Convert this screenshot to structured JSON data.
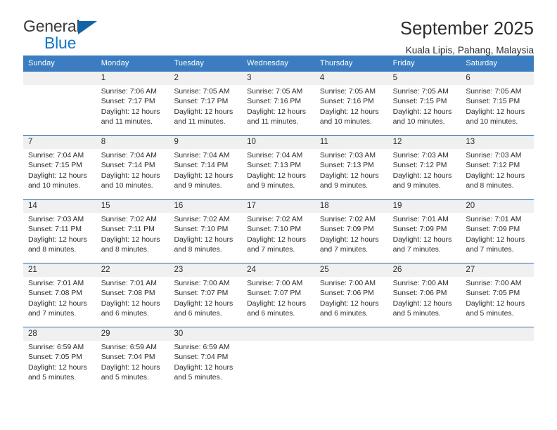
{
  "logo": {
    "primary_text": "General",
    "secondary_text": "Blue",
    "primary_color": "#3a3a3a",
    "secondary_color": "#1277c4",
    "triangle_color": "#1064a8"
  },
  "header": {
    "month_title": "September 2025",
    "location": "Kuala Lipis, Pahang, Malaysia"
  },
  "theme": {
    "header_bg": "#3b7dc0",
    "header_text": "#ffffff",
    "week_divider": "#2f6fad",
    "daynum_bg": "#f0f0f0",
    "body_text": "#2b2b2b"
  },
  "weekdays": [
    "Sunday",
    "Monday",
    "Tuesday",
    "Wednesday",
    "Thursday",
    "Friday",
    "Saturday"
  ],
  "weeks": [
    {
      "days": [
        {
          "date": "",
          "sunrise": "",
          "sunset": "",
          "daylight_line1": "",
          "daylight_line2": "",
          "empty": true
        },
        {
          "date": "1",
          "sunrise": "Sunrise: 7:06 AM",
          "sunset": "Sunset: 7:17 PM",
          "daylight_line1": "Daylight: 12 hours",
          "daylight_line2": "and 11 minutes.",
          "empty": false
        },
        {
          "date": "2",
          "sunrise": "Sunrise: 7:05 AM",
          "sunset": "Sunset: 7:17 PM",
          "daylight_line1": "Daylight: 12 hours",
          "daylight_line2": "and 11 minutes.",
          "empty": false
        },
        {
          "date": "3",
          "sunrise": "Sunrise: 7:05 AM",
          "sunset": "Sunset: 7:16 PM",
          "daylight_line1": "Daylight: 12 hours",
          "daylight_line2": "and 11 minutes.",
          "empty": false
        },
        {
          "date": "4",
          "sunrise": "Sunrise: 7:05 AM",
          "sunset": "Sunset: 7:16 PM",
          "daylight_line1": "Daylight: 12 hours",
          "daylight_line2": "and 10 minutes.",
          "empty": false
        },
        {
          "date": "5",
          "sunrise": "Sunrise: 7:05 AM",
          "sunset": "Sunset: 7:15 PM",
          "daylight_line1": "Daylight: 12 hours",
          "daylight_line2": "and 10 minutes.",
          "empty": false
        },
        {
          "date": "6",
          "sunrise": "Sunrise: 7:05 AM",
          "sunset": "Sunset: 7:15 PM",
          "daylight_line1": "Daylight: 12 hours",
          "daylight_line2": "and 10 minutes.",
          "empty": false
        }
      ]
    },
    {
      "days": [
        {
          "date": "7",
          "sunrise": "Sunrise: 7:04 AM",
          "sunset": "Sunset: 7:15 PM",
          "daylight_line1": "Daylight: 12 hours",
          "daylight_line2": "and 10 minutes.",
          "empty": false
        },
        {
          "date": "8",
          "sunrise": "Sunrise: 7:04 AM",
          "sunset": "Sunset: 7:14 PM",
          "daylight_line1": "Daylight: 12 hours",
          "daylight_line2": "and 10 minutes.",
          "empty": false
        },
        {
          "date": "9",
          "sunrise": "Sunrise: 7:04 AM",
          "sunset": "Sunset: 7:14 PM",
          "daylight_line1": "Daylight: 12 hours",
          "daylight_line2": "and 9 minutes.",
          "empty": false
        },
        {
          "date": "10",
          "sunrise": "Sunrise: 7:04 AM",
          "sunset": "Sunset: 7:13 PM",
          "daylight_line1": "Daylight: 12 hours",
          "daylight_line2": "and 9 minutes.",
          "empty": false
        },
        {
          "date": "11",
          "sunrise": "Sunrise: 7:03 AM",
          "sunset": "Sunset: 7:13 PM",
          "daylight_line1": "Daylight: 12 hours",
          "daylight_line2": "and 9 minutes.",
          "empty": false
        },
        {
          "date": "12",
          "sunrise": "Sunrise: 7:03 AM",
          "sunset": "Sunset: 7:12 PM",
          "daylight_line1": "Daylight: 12 hours",
          "daylight_line2": "and 9 minutes.",
          "empty": false
        },
        {
          "date": "13",
          "sunrise": "Sunrise: 7:03 AM",
          "sunset": "Sunset: 7:12 PM",
          "daylight_line1": "Daylight: 12 hours",
          "daylight_line2": "and 8 minutes.",
          "empty": false
        }
      ]
    },
    {
      "days": [
        {
          "date": "14",
          "sunrise": "Sunrise: 7:03 AM",
          "sunset": "Sunset: 7:11 PM",
          "daylight_line1": "Daylight: 12 hours",
          "daylight_line2": "and 8 minutes.",
          "empty": false
        },
        {
          "date": "15",
          "sunrise": "Sunrise: 7:02 AM",
          "sunset": "Sunset: 7:11 PM",
          "daylight_line1": "Daylight: 12 hours",
          "daylight_line2": "and 8 minutes.",
          "empty": false
        },
        {
          "date": "16",
          "sunrise": "Sunrise: 7:02 AM",
          "sunset": "Sunset: 7:10 PM",
          "daylight_line1": "Daylight: 12 hours",
          "daylight_line2": "and 8 minutes.",
          "empty": false
        },
        {
          "date": "17",
          "sunrise": "Sunrise: 7:02 AM",
          "sunset": "Sunset: 7:10 PM",
          "daylight_line1": "Daylight: 12 hours",
          "daylight_line2": "and 7 minutes.",
          "empty": false
        },
        {
          "date": "18",
          "sunrise": "Sunrise: 7:02 AM",
          "sunset": "Sunset: 7:09 PM",
          "daylight_line1": "Daylight: 12 hours",
          "daylight_line2": "and 7 minutes.",
          "empty": false
        },
        {
          "date": "19",
          "sunrise": "Sunrise: 7:01 AM",
          "sunset": "Sunset: 7:09 PM",
          "daylight_line1": "Daylight: 12 hours",
          "daylight_line2": "and 7 minutes.",
          "empty": false
        },
        {
          "date": "20",
          "sunrise": "Sunrise: 7:01 AM",
          "sunset": "Sunset: 7:09 PM",
          "daylight_line1": "Daylight: 12 hours",
          "daylight_line2": "and 7 minutes.",
          "empty": false
        }
      ]
    },
    {
      "days": [
        {
          "date": "21",
          "sunrise": "Sunrise: 7:01 AM",
          "sunset": "Sunset: 7:08 PM",
          "daylight_line1": "Daylight: 12 hours",
          "daylight_line2": "and 7 minutes.",
          "empty": false
        },
        {
          "date": "22",
          "sunrise": "Sunrise: 7:01 AM",
          "sunset": "Sunset: 7:08 PM",
          "daylight_line1": "Daylight: 12 hours",
          "daylight_line2": "and 6 minutes.",
          "empty": false
        },
        {
          "date": "23",
          "sunrise": "Sunrise: 7:00 AM",
          "sunset": "Sunset: 7:07 PM",
          "daylight_line1": "Daylight: 12 hours",
          "daylight_line2": "and 6 minutes.",
          "empty": false
        },
        {
          "date": "24",
          "sunrise": "Sunrise: 7:00 AM",
          "sunset": "Sunset: 7:07 PM",
          "daylight_line1": "Daylight: 12 hours",
          "daylight_line2": "and 6 minutes.",
          "empty": false
        },
        {
          "date": "25",
          "sunrise": "Sunrise: 7:00 AM",
          "sunset": "Sunset: 7:06 PM",
          "daylight_line1": "Daylight: 12 hours",
          "daylight_line2": "and 6 minutes.",
          "empty": false
        },
        {
          "date": "26",
          "sunrise": "Sunrise: 7:00 AM",
          "sunset": "Sunset: 7:06 PM",
          "daylight_line1": "Daylight: 12 hours",
          "daylight_line2": "and 5 minutes.",
          "empty": false
        },
        {
          "date": "27",
          "sunrise": "Sunrise: 7:00 AM",
          "sunset": "Sunset: 7:05 PM",
          "daylight_line1": "Daylight: 12 hours",
          "daylight_line2": "and 5 minutes.",
          "empty": false
        }
      ]
    },
    {
      "days": [
        {
          "date": "28",
          "sunrise": "Sunrise: 6:59 AM",
          "sunset": "Sunset: 7:05 PM",
          "daylight_line1": "Daylight: 12 hours",
          "daylight_line2": "and 5 minutes.",
          "empty": false
        },
        {
          "date": "29",
          "sunrise": "Sunrise: 6:59 AM",
          "sunset": "Sunset: 7:04 PM",
          "daylight_line1": "Daylight: 12 hours",
          "daylight_line2": "and 5 minutes.",
          "empty": false
        },
        {
          "date": "30",
          "sunrise": "Sunrise: 6:59 AM",
          "sunset": "Sunset: 7:04 PM",
          "daylight_line1": "Daylight: 12 hours",
          "daylight_line2": "and 5 minutes.",
          "empty": false
        },
        {
          "date": "",
          "sunrise": "",
          "sunset": "",
          "daylight_line1": "",
          "daylight_line2": "",
          "empty": true
        },
        {
          "date": "",
          "sunrise": "",
          "sunset": "",
          "daylight_line1": "",
          "daylight_line2": "",
          "empty": true
        },
        {
          "date": "",
          "sunrise": "",
          "sunset": "",
          "daylight_line1": "",
          "daylight_line2": "",
          "empty": true
        },
        {
          "date": "",
          "sunrise": "",
          "sunset": "",
          "daylight_line1": "",
          "daylight_line2": "",
          "empty": true
        }
      ]
    }
  ]
}
